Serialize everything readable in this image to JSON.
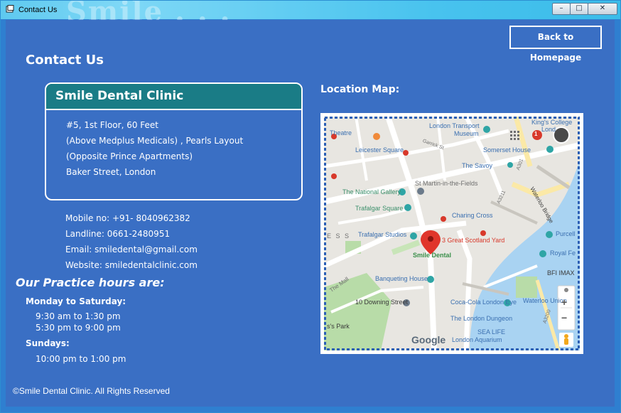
{
  "window": {
    "title": "Contact Us",
    "watermark": "Smile . . .",
    "controls": {
      "minimize": "–",
      "maximize": "□",
      "close": "✕"
    }
  },
  "header": {
    "back_button": "Back to Homepage",
    "page_title": "Contact Us"
  },
  "clinic": {
    "name": "Smile Dental Clinic",
    "address": [
      "#5, 1st Floor, 60 Feet",
      "(Above Medplus Medicals) , Pearls Layout",
      "(Opposite Prince Apartments)",
      "Baker Street, London"
    ]
  },
  "contact": {
    "mobile": "Mobile no: +91- 8040962382",
    "landline": "Landline: 0661-2480951",
    "email": "Email: smiledental@gmail.com",
    "website": "Website: smiledentalclinic.com"
  },
  "hours": {
    "title": "Our Practice hours are:",
    "weekday_label": "Monday to Saturday:",
    "weekday_1": "9:30 am to 1:30 pm",
    "weekday_2": "5:30 pm to 9:00 pm",
    "sunday_label": "Sundays:",
    "sunday_1": "10:00 pm to 1:00 pm"
  },
  "map": {
    "label": "Location Map:",
    "places": {
      "theatre": "Theatre",
      "ltm1": "London Transport",
      "ltm2": "Museum",
      "kings1": "King's College",
      "kings2": "Lond",
      "leicester": "Leicester Square",
      "somerset": "Somerset House",
      "garrick": "Garrick St",
      "savoy": "The Savoy",
      "stmartin": "St Martin-in-the-Fields",
      "gallery": "The National Gallery",
      "trafalgar": "Trafalgar Square",
      "charing": "Charing Cross",
      "studios": "Trafalgar Studios",
      "scotland": "3 Great Scotland Yard",
      "smile": "Smile Dental",
      "purcell": "Purcell",
      "royal": "Royal Fe",
      "banqueting": "Banqueting House",
      "bfi": "BFI IMAX",
      "downing": "10 Downing Street",
      "eye": "Coca-Cola London Eye",
      "waterloo": "Waterloo Union",
      "dungeon": "The London Dungeon",
      "sealife1": "SEA LIFE",
      "sealife2": "London Aquarium",
      "park": "s's Park",
      "mall": "The Mall",
      "es": "E S  S",
      "google": "Google",
      "a3211": "A3211",
      "a301": "A301",
      "a3200": "A3200",
      "waterloo_bridge": "Waterloo Bridge",
      "badge": "1"
    },
    "zoom_in": "+",
    "zoom_out": "−"
  },
  "footer": {
    "copyright": "©Smile Dental Clinic. All Rights Reserved"
  }
}
